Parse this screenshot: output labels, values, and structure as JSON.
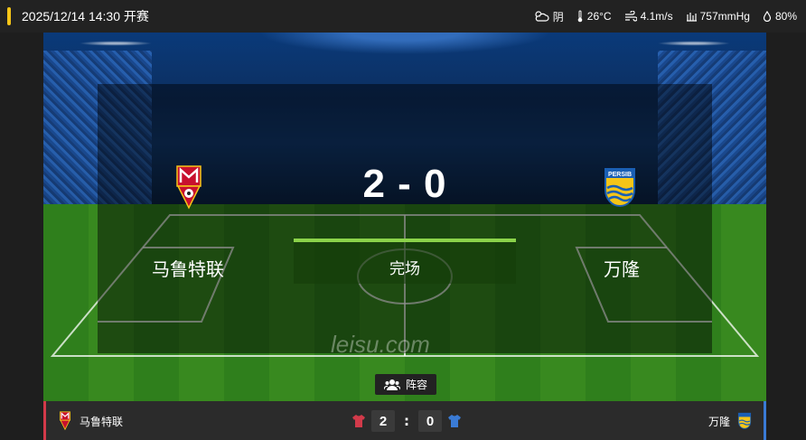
{
  "header": {
    "datetime": "2025/12/14 14:30 开赛",
    "weather": {
      "condition": "阴",
      "temperature": "26°C",
      "wind": "4.1m/s",
      "pressure": "757mmHg",
      "humidity": "80%"
    },
    "accent_color": "#f5c518"
  },
  "match": {
    "home_team": "马鲁特联",
    "away_team": "万隆",
    "score": "2 - 0",
    "home_score": "2",
    "away_score": "0",
    "status": "完场",
    "watermark": "leisu.com",
    "away_logo_text": "PERSIB"
  },
  "actions": {
    "lineup_label": "阵容"
  },
  "colors": {
    "home": "#d23a4a",
    "away": "#3a7bd5",
    "status_bar": "#8bd34a"
  }
}
